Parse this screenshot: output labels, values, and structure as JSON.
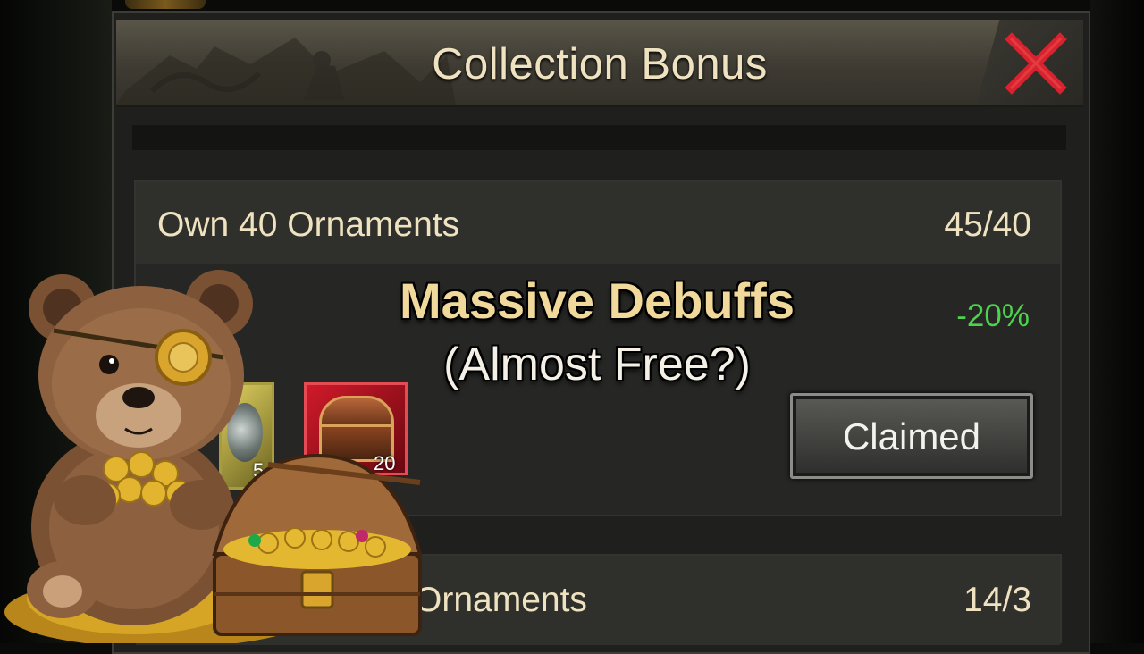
{
  "window": {
    "title": "Collection Bonus",
    "close_icon": "close-icon"
  },
  "bonus_card_1": {
    "title": "Own 40 Ornaments",
    "progress": "45/40",
    "bonus_value": "-20%",
    "claim_button_label": "Claimed",
    "rewards": [
      {
        "icon": "ornament-icon",
        "count": "5"
      },
      {
        "icon": "treasure-chest-icon",
        "count": "20"
      }
    ]
  },
  "bonus_card_2": {
    "title": "Ornaments",
    "progress": "14/3"
  },
  "overlay": {
    "headline": "Massive Debuffs",
    "subheadline": "(Almost Free?)"
  },
  "colors": {
    "title_text": "#efe2c0",
    "bonus_green": "#4ed14e",
    "close_red": "#d8232e",
    "headline_gold": "#f1d99b"
  }
}
